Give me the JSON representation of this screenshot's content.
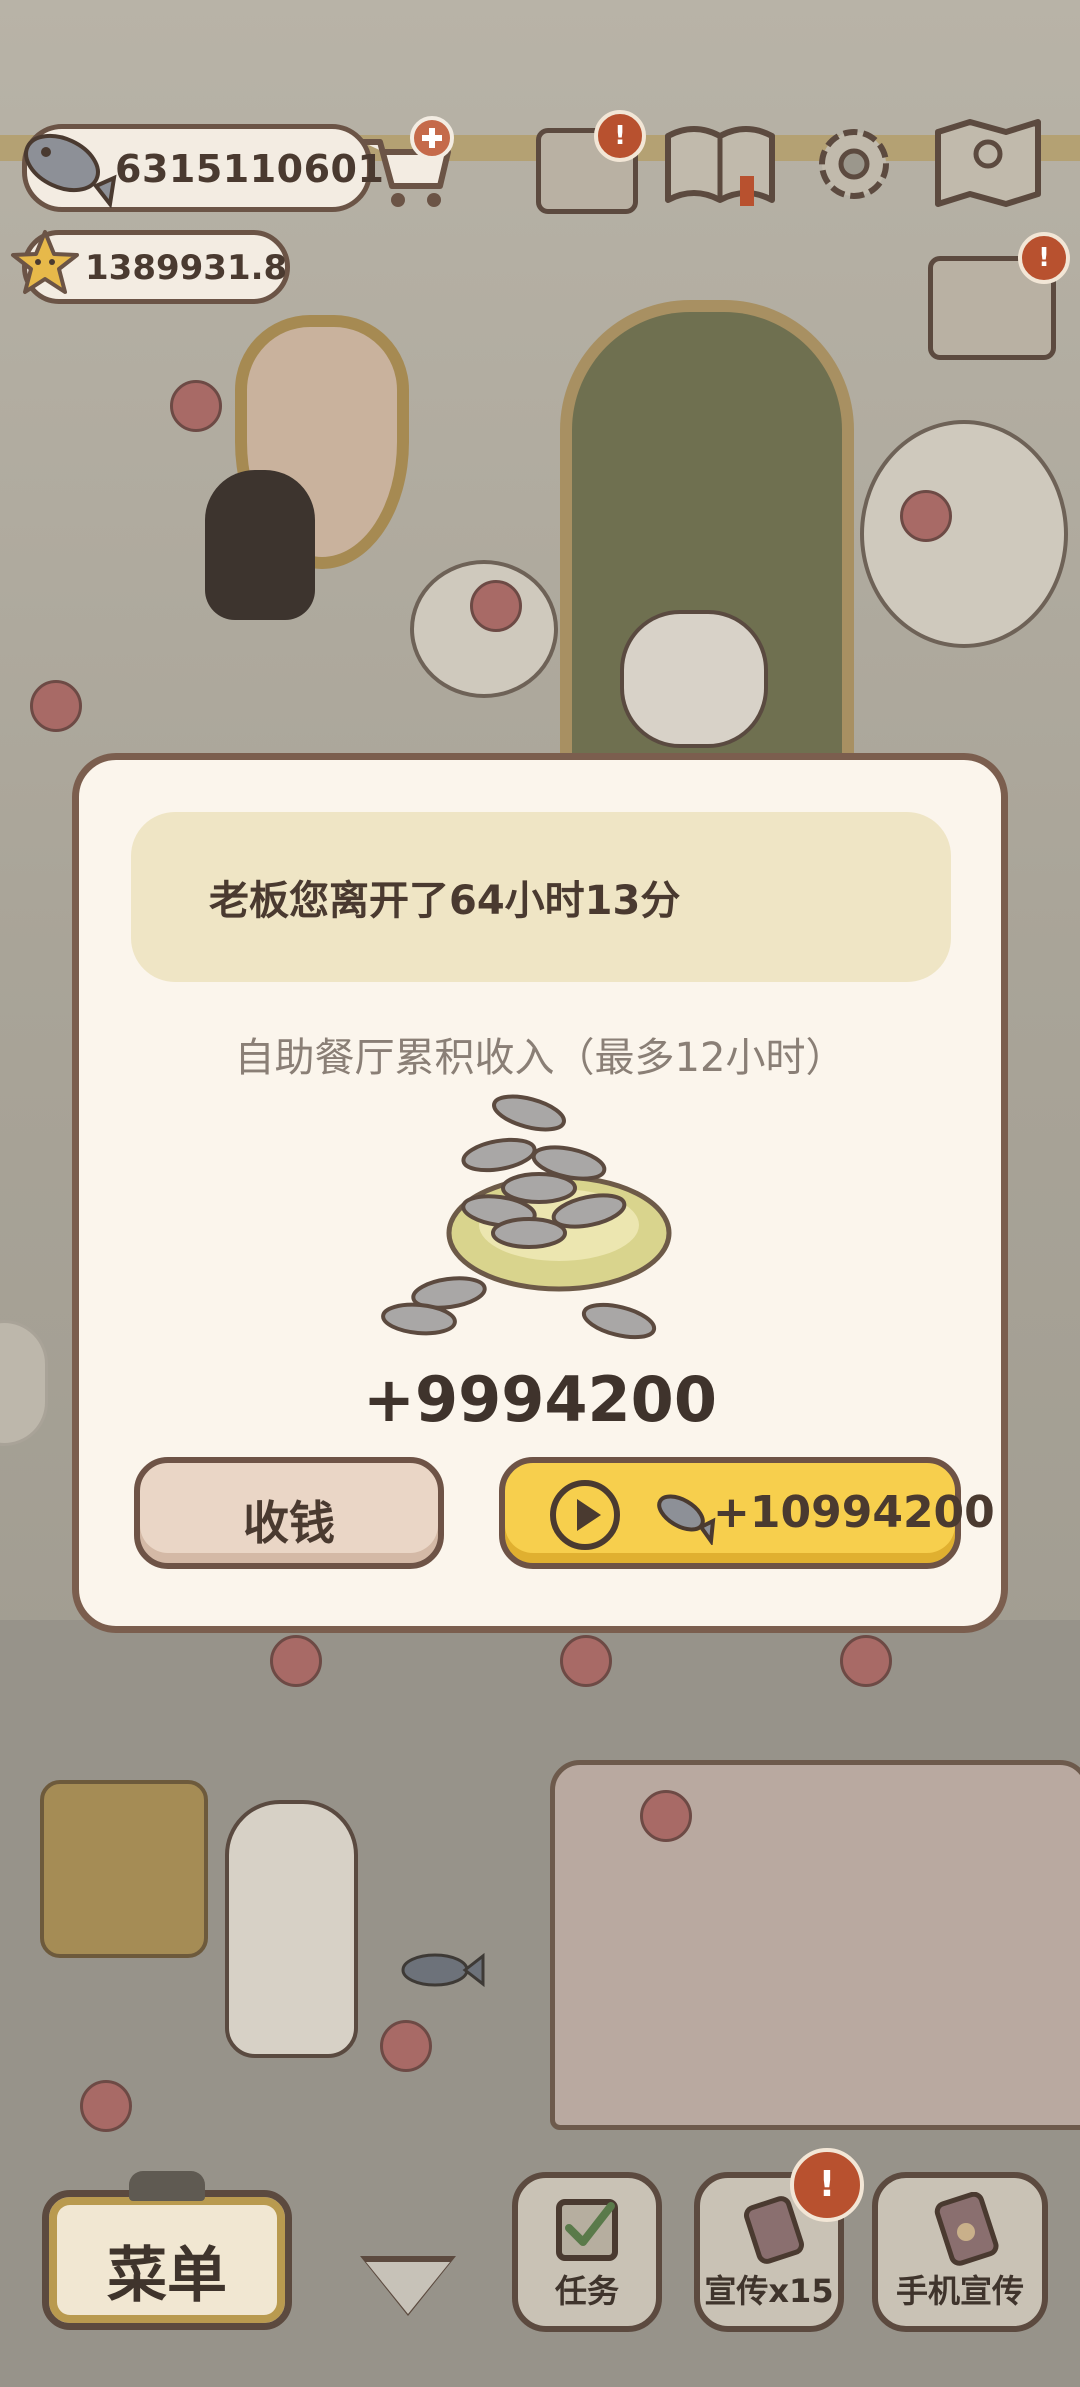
{
  "hud": {
    "fish_count": "6315110601",
    "star_count": "1389931.8",
    "notification_badge": "!"
  },
  "dialog": {
    "message": "老板您离开了64小时13分",
    "subtitle": "自助餐厅累积收入（最多12小时）",
    "amount": "+9994200",
    "collect_label": "收钱",
    "video_reward": "+10994200"
  },
  "bottom_bar": {
    "menu_label": "菜单",
    "tasks_label": "任务",
    "promote_label": "宣传x15",
    "phone_promote_label": "手机宣传"
  },
  "colors": {
    "accent_yellow": "#f7cf4d",
    "border_brown": "#7b5e4e",
    "badge_red": "#b8512f"
  },
  "icons": [
    "fish-icon",
    "cart-plus-icon",
    "star-icon",
    "mail-icon",
    "book-icon",
    "gear-icon",
    "map-icon",
    "sort-icon",
    "play-icon",
    "checklist-icon",
    "phone-icon"
  ]
}
